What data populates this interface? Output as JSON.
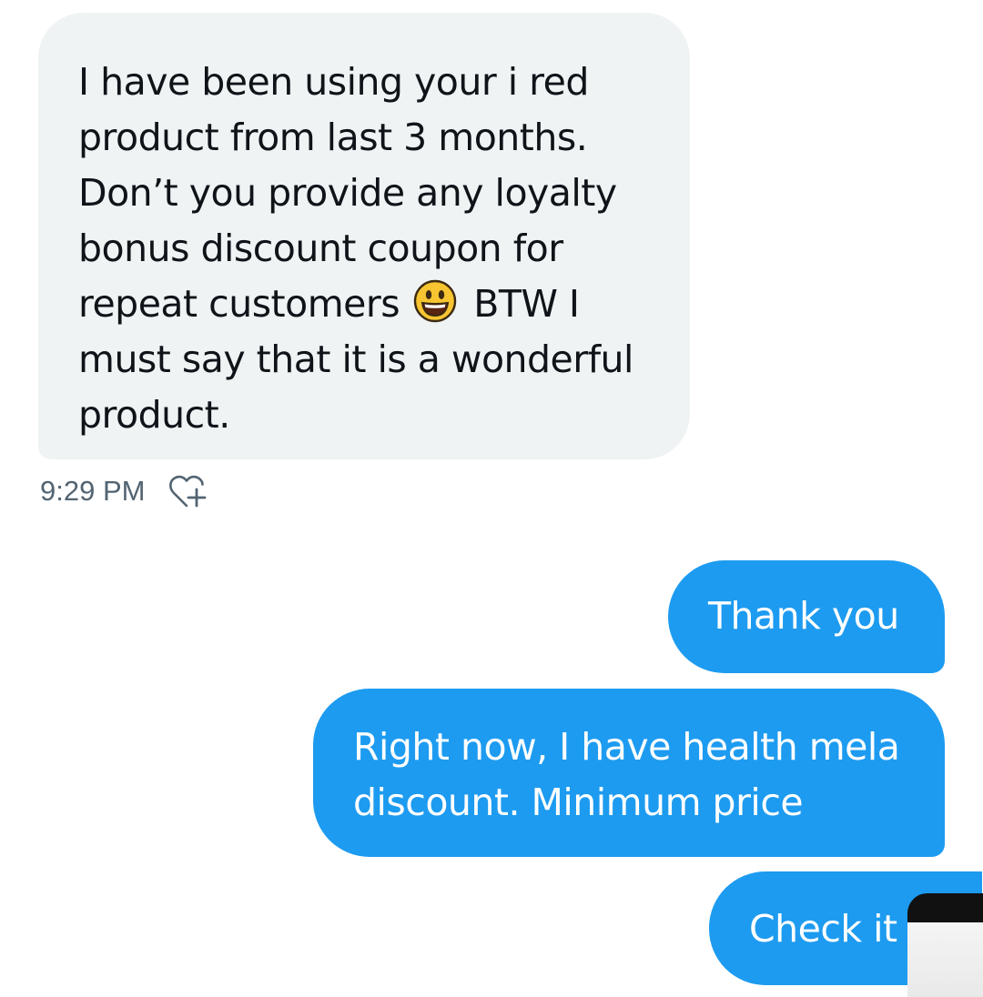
{
  "conversation": {
    "incoming_message": {
      "lines": [
        "I have been using your i red",
        "product from last 3 months.",
        "Don’t you provide any loyalty",
        "bonus discount coupon for"
      ],
      "line5_before_emoji": "repeat customers",
      "emoji": "grinning-face-icon",
      "line5_after_emoji": "BTW I",
      "line6": "must say that it is a wonderful",
      "line7": "product."
    },
    "timestamp": "9:29 PM",
    "outgoing_messages": {
      "first": "Thank you",
      "second_lines": [
        "Right now, I have health mela",
        "discount. Minimum price"
      ],
      "third": "Check it"
    }
  },
  "colors": {
    "incoming_bubble": "#eff3f4",
    "outgoing_bubble": "#1d9bf0",
    "incoming_text": "#0f1419",
    "meta_text": "#536471"
  }
}
